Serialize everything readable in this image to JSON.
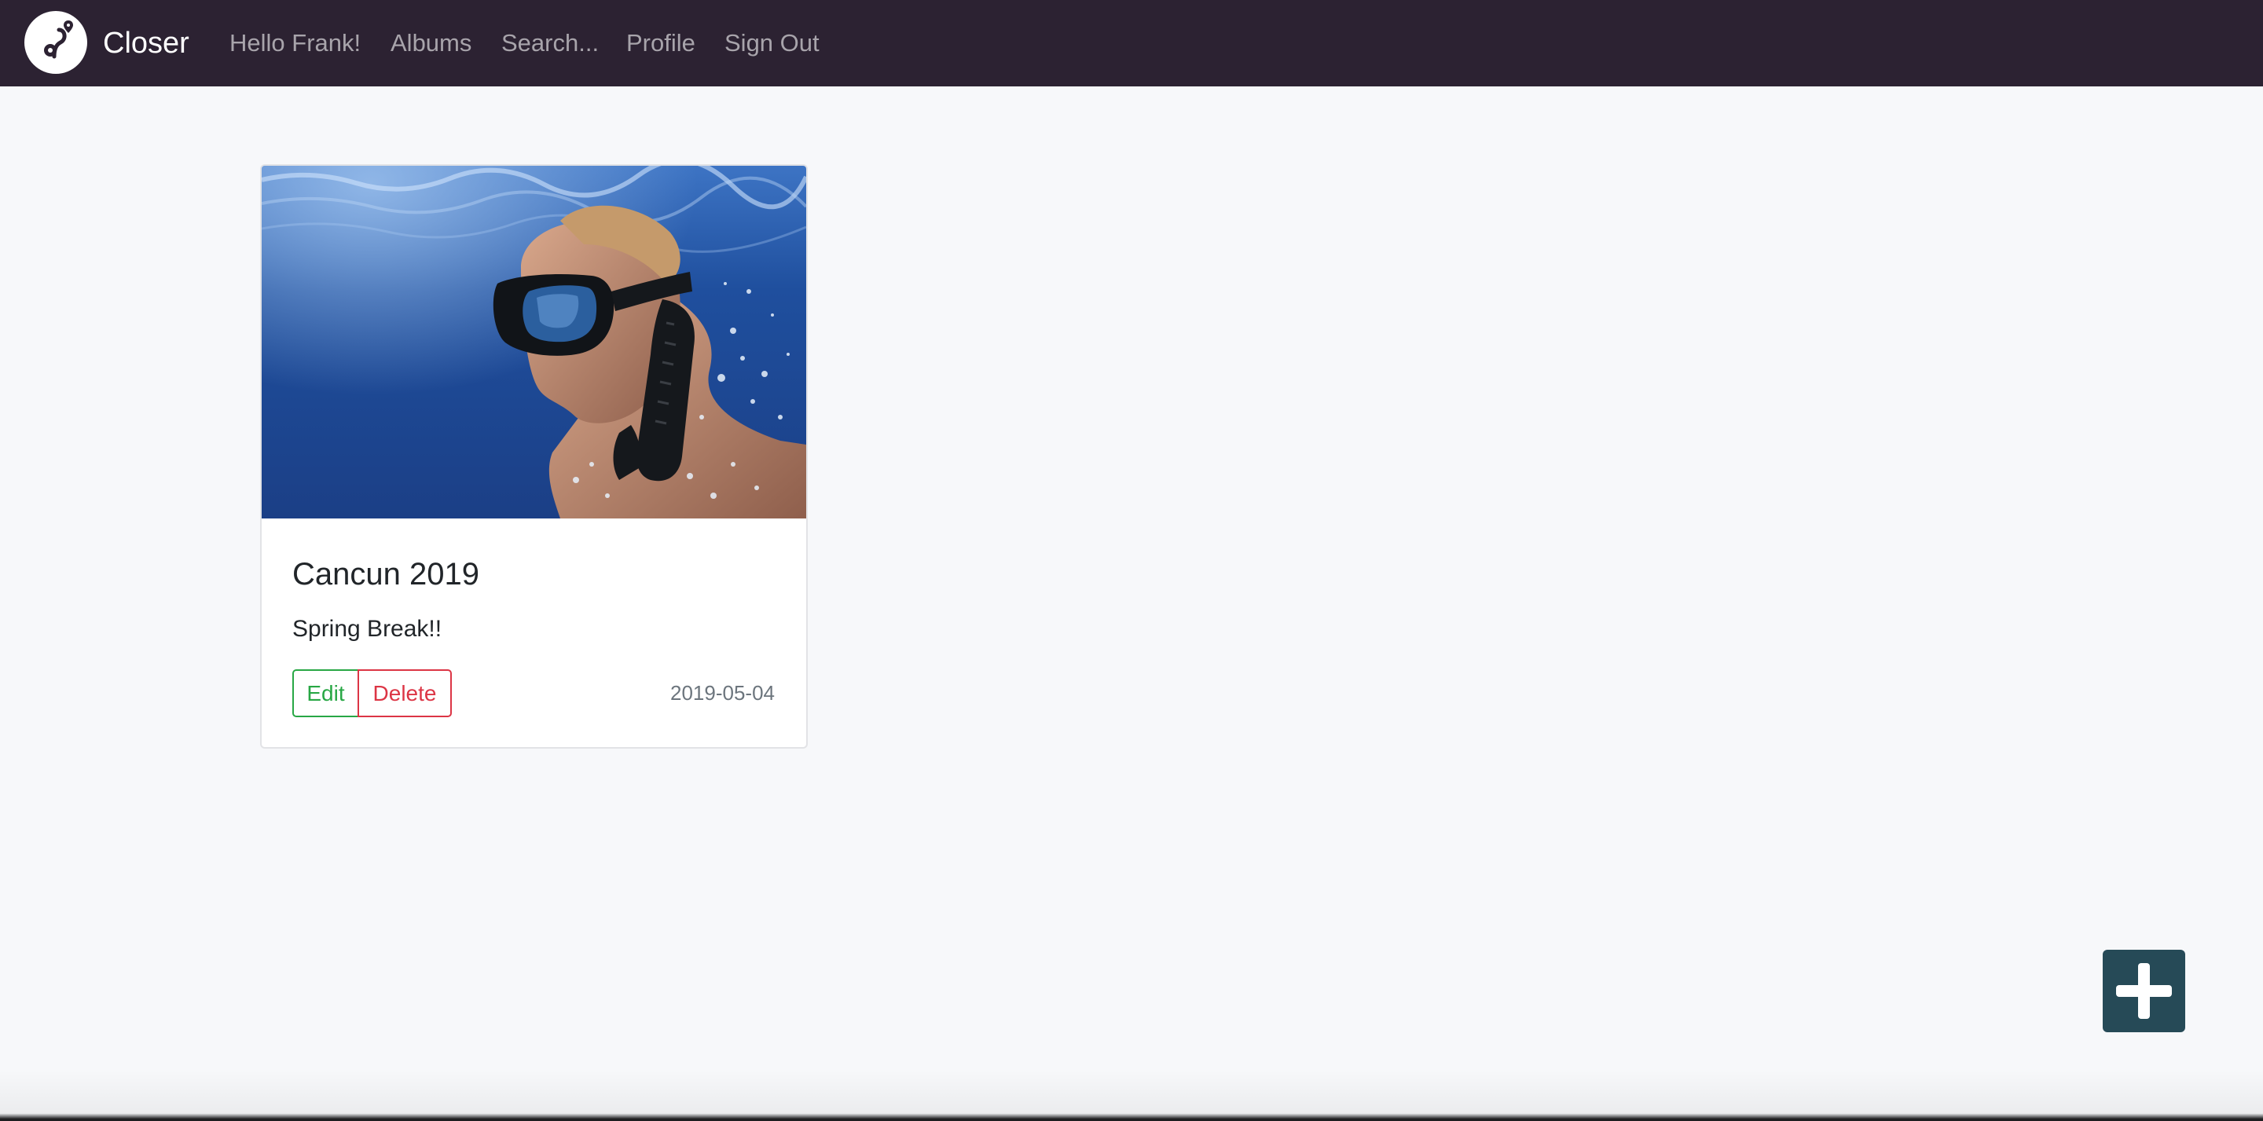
{
  "navbar": {
    "brand": "Closer",
    "links": [
      {
        "label": "Hello Frank!"
      },
      {
        "label": "Albums"
      },
      {
        "label": "Search..."
      },
      {
        "label": "Profile"
      },
      {
        "label": "Sign Out"
      }
    ],
    "background_color": "#2c2232"
  },
  "albums": [
    {
      "title": "Cancun 2019",
      "description": "Spring Break!!",
      "date": "2019-05-04",
      "edit_label": "Edit",
      "delete_label": "Delete",
      "photo_icon": "snorkeler-photo"
    }
  ],
  "add_button": {
    "icon": "plus-icon",
    "color": "#264a57"
  },
  "colors": {
    "edit": "#28a745",
    "delete": "#dc3545",
    "date": "#6c757d",
    "page_background": "#f7f8fa"
  }
}
